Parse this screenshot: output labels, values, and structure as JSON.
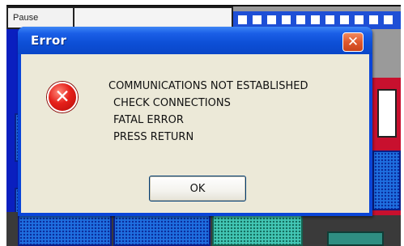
{
  "background_app": {
    "pause_tab_label": "Pause"
  },
  "dialog": {
    "title": "Error",
    "close_glyph": "✕",
    "icon": "error-icon",
    "icon_glyph": "✕",
    "message_lines": [
      "COMMUNICATIONS NOT ESTABLISHED",
      "CHECK CONNECTIONS",
      "FATAL ERROR",
      "PRESS RETURN"
    ],
    "ok_label": "OK"
  },
  "colors": {
    "titlebar_blue": "#0a45d8",
    "client_beige": "#ece9d8",
    "close_orange": "#e0582e",
    "error_red": "#e5201a"
  }
}
